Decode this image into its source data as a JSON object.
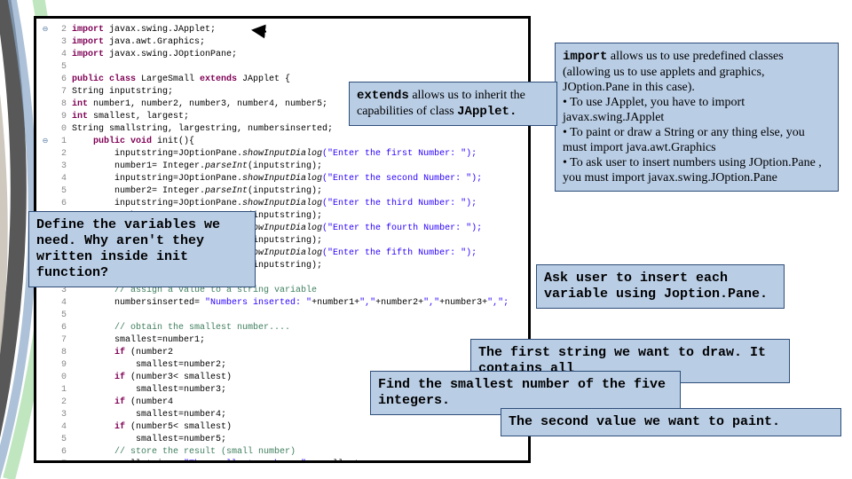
{
  "code": {
    "lines": [
      {
        "n": "2",
        "pre": "",
        "kw": "import",
        "rest": " javax.swing.JApplet;"
      },
      {
        "n": "3",
        "pre": "",
        "kw": "import",
        "rest": " java.awt.Graphics;"
      },
      {
        "n": "4",
        "pre": "",
        "kw": "import",
        "rest": " javax.swing.JOptionPane;"
      },
      {
        "n": "5",
        "pre": "",
        "kw": "",
        "rest": ""
      },
      {
        "n": "6",
        "pre": "",
        "kw": "public class",
        "rest": " LargeSmall ",
        "kw2": "extends",
        "rest2": " JApplet {"
      },
      {
        "n": "7",
        "pre": "",
        "kw": "",
        "rest": "String inputstring;"
      },
      {
        "n": "8",
        "pre": "",
        "kw": "int",
        "rest": " number1, number2, number3, number4, number5;"
      },
      {
        "n": "9",
        "pre": "",
        "kw": "int",
        "rest": " smallest, largest;"
      },
      {
        "n": "0",
        "pre": "",
        "kw": "",
        "rest": "String smallstring, largestring, numbersinserted;"
      },
      {
        "n": "1",
        "pre": "",
        "kw": "",
        "rest": "    ",
        "kw2": "public void",
        "rest2": " init(){"
      },
      {
        "n": "2",
        "pre": "        ",
        "kw": "",
        "rest": "inputstring=JOptionPane.",
        "it": "showInputDialog",
        "st": "(\"Enter the first Number: \");"
      },
      {
        "n": "3",
        "pre": "        ",
        "kw": "",
        "rest": "number1= Integer.",
        "it": "parseInt",
        "tail": "(inputstring);"
      },
      {
        "n": "4",
        "pre": "        ",
        "kw": "",
        "rest": "inputstring=JOptionPane.",
        "it": "showInputDialog",
        "st": "(\"Enter the second Number: \");"
      },
      {
        "n": "5",
        "pre": "        ",
        "kw": "",
        "rest": "number2= Integer.",
        "it": "parseInt",
        "tail": "(inputstring);"
      },
      {
        "n": "6",
        "pre": "        ",
        "kw": "",
        "rest": "inputstring=JOptionPane.",
        "it": "showInputDialog",
        "st": "(\"Enter the third Number: \");"
      },
      {
        "n": "7",
        "pre": "        ",
        "kw": "",
        "rest": "number3= Integer.",
        "it": "parseInt",
        "tail": "(inputstring);"
      },
      {
        "n": "8",
        "pre": "        ",
        "kw": "",
        "rest": "inputstring=JOptionPane.",
        "it": "showInputDialog",
        "st": "(\"Enter the fourth Number: \");"
      },
      {
        "n": "9",
        "pre": "        ",
        "kw": "",
        "rest": "number4= Integer.",
        "it": "parseInt",
        "tail": "(inputstring);"
      },
      {
        "n": "0",
        "pre": "        ",
        "kw": "",
        "rest": "inputstring=JOptionPane.",
        "it": "showInputDialog",
        "st": "(\"Enter the fifth Number: \");"
      },
      {
        "n": "1",
        "pre": "        ",
        "kw": "",
        "rest": "number5= Integer.",
        "it": "parseInt",
        "tail": "(inputstring);"
      },
      {
        "n": "2",
        "pre": "",
        "kw": "",
        "rest": ""
      },
      {
        "n": "3",
        "pre": "        ",
        "cm": "// assign a value to a string variable"
      },
      {
        "n": "4",
        "pre": "        ",
        "kw": "",
        "rest": "numbersinserted= ",
        "st": "\"Numbers inserted: \"",
        "rest3": "+number1+",
        "st2": "\",\"",
        "rest4": "+number2+",
        "st3": "\",\"",
        "rest5": "+number3+",
        "st4": "\",\";"
      },
      {
        "n": "5",
        "pre": "",
        "kw": "",
        "rest": ""
      },
      {
        "n": "6",
        "pre": "        ",
        "cm": "// obtain the smallest number...."
      },
      {
        "n": "7",
        "pre": "        ",
        "kw": "",
        "rest": "smallest=number1;"
      },
      {
        "n": "8",
        "pre": "        ",
        "kw": "if",
        "rest": " (number2<smallest)"
      },
      {
        "n": "9",
        "pre": "            ",
        "kw": "",
        "rest": "smallest=number2;"
      },
      {
        "n": "0",
        "pre": "        ",
        "kw": "if",
        "rest": " (number3< smallest)"
      },
      {
        "n": "1",
        "pre": "            ",
        "kw": "",
        "rest": "smallest=number3;"
      },
      {
        "n": "2",
        "pre": "        ",
        "kw": "if",
        "rest": " (number4<smallest)"
      },
      {
        "n": "3",
        "pre": "            ",
        "kw": "",
        "rest": "smallest=number4;"
      },
      {
        "n": "4",
        "pre": "        ",
        "kw": "if",
        "rest": " (number5< smallest)"
      },
      {
        "n": "5",
        "pre": "            ",
        "kw": "",
        "rest": "smallest=number5;"
      },
      {
        "n": "6",
        "pre": "        ",
        "cm": "// store the result (small number)"
      },
      {
        "n": "7",
        "pre": "        ",
        "kw": "",
        "rest": "smallstring= ",
        "st": "\"The smallest number: \"",
        "rest3": "+ smallest;"
      }
    ]
  },
  "callouts": {
    "import": {
      "lead": "import",
      "body": " allows us to use predefined classes (allowing us to use applets and graphics, JOption.Pane in this case).",
      "b1": "• To use JApplet, you have to import javax.swing.JApplet",
      "b2": "• To paint or draw a String or any thing else, you must import java.awt.Graphics",
      "b3": "• To ask user to insert numbers using JOption.Pane , you must import javax.swing.JOption.Pane"
    },
    "extends": {
      "lead": "extends",
      "mid": " allows us to inherit the capabilities of class ",
      "tail": "JApplet."
    },
    "vars": "Define the variables we need. Why aren't they written inside init function?",
    "ask": "Ask user to insert each variable using Joption.Pane.",
    "firststr": "The first string we want to draw. It contains all",
    "smallest": "Find the smallest number of the five integers.",
    "second": "The second value we want to paint."
  }
}
